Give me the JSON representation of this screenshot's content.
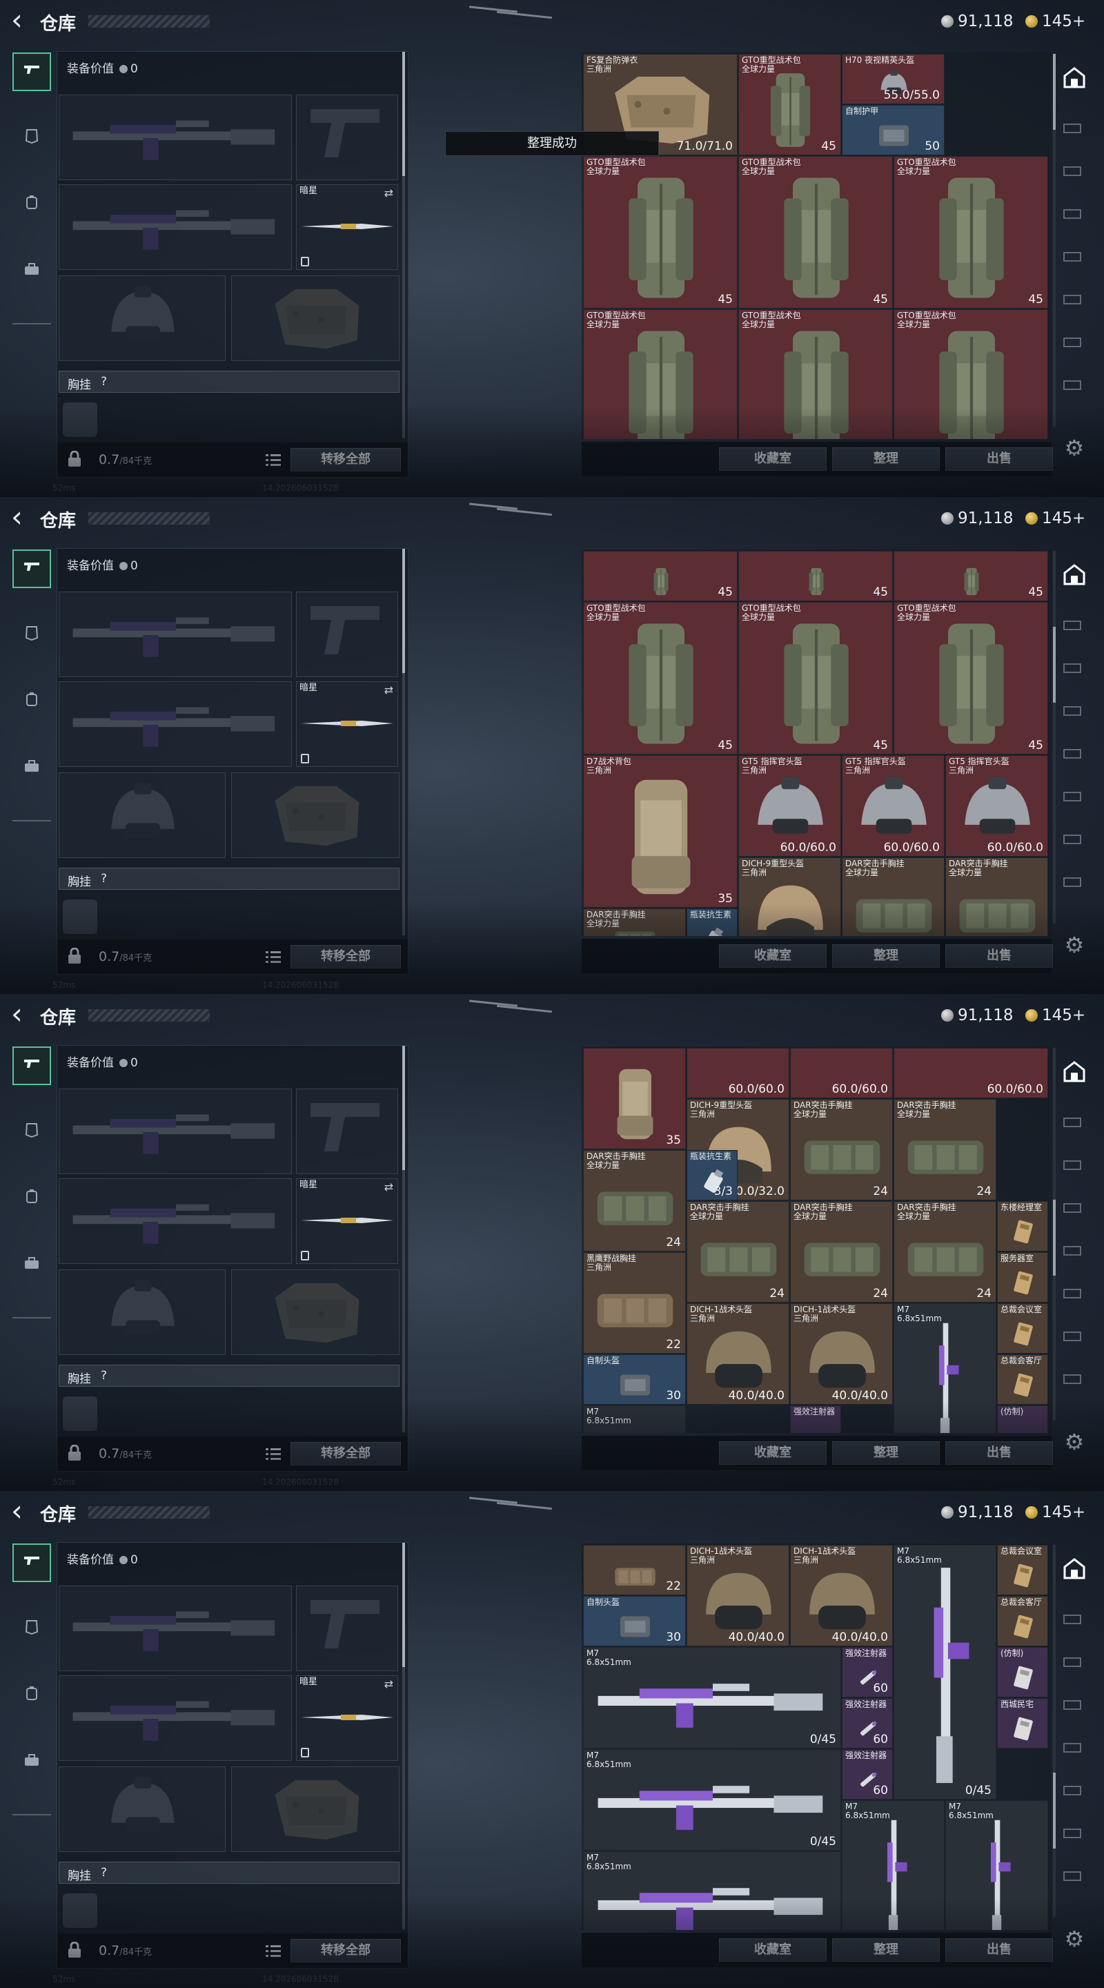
{
  "app": {
    "title": "仓库",
    "back_icon": "back-arrow-icon"
  },
  "currency": {
    "silver": "91,118",
    "gold": "145+"
  },
  "left_nav": [
    "gun-icon",
    "armor-icon",
    "backpack-icon",
    "briefcase-icon"
  ],
  "equipment": {
    "value_label": "装备价值",
    "value": "0",
    "secondary_slot_label": "暗星",
    "chest_label": "胸挂",
    "chest_help": "?",
    "weight": "0.7",
    "weight_unit": "/84千克",
    "transfer_all": "转移全部"
  },
  "inventory_footer": {
    "collection": "收藏室",
    "organize": "整理",
    "sell": "出售"
  },
  "toast": "整理成功",
  "status": {
    "ping": "52ms",
    "build": "14.20260603152B"
  },
  "panels": [
    {
      "cells": [
        {
          "name": "FS复合防弹衣\n三角洲",
          "value": "71.0/71.0",
          "bg": "brown",
          "art": "vest",
          "c": 0,
          "r": 0,
          "w": 3,
          "h": 2
        },
        {
          "name": "GTO重型战术包\n全球力量",
          "value": "45",
          "bg": "red",
          "art": "backpack",
          "c": 3,
          "r": 0,
          "w": 2,
          "h": 2
        },
        {
          "name": "H70 夜视精英头盔",
          "value": "55.0/55.0",
          "bg": "red",
          "art": "helmet",
          "c": 5,
          "r": 0,
          "w": 2,
          "h": 1
        },
        {
          "name": "自制护甲",
          "value": "50",
          "bg": "blue",
          "art": "plate",
          "c": 5,
          "r": 1,
          "w": 2,
          "h": 1
        },
        {
          "name": "GTO重型战术包\n全球力量",
          "value": "45",
          "bg": "red",
          "art": "backpack",
          "c": 0,
          "r": 2,
          "w": 3,
          "h": 3
        },
        {
          "name": "GTO重型战术包\n全球力量",
          "value": "45",
          "bg": "red",
          "art": "backpack",
          "c": 3,
          "r": 2,
          "w": 3,
          "h": 3
        },
        {
          "name": "GTO重型战术包\n全球力量",
          "value": "45",
          "bg": "red",
          "art": "backpack",
          "c": 6,
          "r": 2,
          "w": 3,
          "h": 3
        },
        {
          "name": "GTO重型战术包\n全球力量",
          "value": "",
          "bg": "red",
          "art": "backpack",
          "c": 0,
          "r": 5,
          "w": 3,
          "h": 3
        },
        {
          "name": "GTO重型战术包\n全球力量",
          "value": "",
          "bg": "red",
          "art": "backpack",
          "c": 3,
          "r": 5,
          "w": 3,
          "h": 3
        },
        {
          "name": "GTO重型战术包\n全球力量",
          "value": "",
          "bg": "red",
          "art": "backpack",
          "c": 6,
          "r": 5,
          "w": 3,
          "h": 3
        }
      ]
    },
    {
      "cells": [
        {
          "name": "",
          "value": "45",
          "bg": "red",
          "art": "backpack",
          "c": 0,
          "r": 0,
          "w": 3,
          "h": 1
        },
        {
          "name": "",
          "value": "45",
          "bg": "red",
          "art": "backpack",
          "c": 3,
          "r": 0,
          "w": 3,
          "h": 1
        },
        {
          "name": "",
          "value": "45",
          "bg": "red",
          "art": "backpack",
          "c": 6,
          "r": 0,
          "w": 3,
          "h": 1
        },
        {
          "name": "GTO重型战术包\n全球力量",
          "value": "45",
          "bg": "red",
          "art": "backpack",
          "c": 0,
          "r": 1,
          "w": 3,
          "h": 3
        },
        {
          "name": "GTO重型战术包\n全球力量",
          "value": "45",
          "bg": "red",
          "art": "backpack",
          "c": 3,
          "r": 1,
          "w": 3,
          "h": 3
        },
        {
          "name": "GTO重型战术包\n全球力量",
          "value": "45",
          "bg": "red",
          "art": "backpack",
          "c": 6,
          "r": 1,
          "w": 3,
          "h": 3
        },
        {
          "name": "D7战术背包\n三角洲",
          "value": "35",
          "bg": "red",
          "art": "backpack2",
          "c": 0,
          "r": 4,
          "w": 3,
          "h": 3
        },
        {
          "name": "GT5 指挥官头盔\n三角洲",
          "value": "60.0/60.0",
          "bg": "red",
          "art": "helmet",
          "c": 3,
          "r": 4,
          "w": 2,
          "h": 2
        },
        {
          "name": "GT5 指挥官头盔\n三角洲",
          "value": "60.0/60.0",
          "bg": "red",
          "art": "helmet",
          "c": 5,
          "r": 4,
          "w": 2,
          "h": 2
        },
        {
          "name": "GT5 指挥官头盔\n三角洲",
          "value": "60.0/60.0",
          "bg": "red",
          "art": "helmet",
          "c": 7,
          "r": 4,
          "w": 2,
          "h": 2
        },
        {
          "name": "DICH-9重型头盔\n三角洲",
          "value": "",
          "bg": "brown",
          "art": "helmet2",
          "c": 3,
          "r": 6,
          "w": 2,
          "h": 2
        },
        {
          "name": "DAR突击手胸挂\n全球力量",
          "value": "",
          "bg": "brown",
          "art": "rig",
          "c": 5,
          "r": 6,
          "w": 2,
          "h": 2
        },
        {
          "name": "DAR突击手胸挂\n全球力量",
          "value": "",
          "bg": "brown",
          "art": "rig",
          "c": 7,
          "r": 6,
          "w": 2,
          "h": 2
        },
        {
          "name": "DAR突击手胸挂\n全球力量",
          "value": "",
          "bg": "brown",
          "art": "rig",
          "c": 0,
          "r": 7,
          "w": 2,
          "h": 1
        },
        {
          "name": "瓶装抗生素",
          "value": "",
          "bg": "blue",
          "art": "bottle",
          "c": 2,
          "r": 7,
          "w": 1,
          "h": 1
        }
      ]
    },
    {
      "cells": [
        {
          "name": "",
          "value": "35",
          "bg": "red",
          "art": "backpack2",
          "c": 0,
          "r": 0,
          "w": 2,
          "h": 2
        },
        {
          "name": "",
          "value": "60.0/60.0",
          "bg": "red",
          "art": "none",
          "c": 2,
          "r": 0,
          "w": 2,
          "h": 1
        },
        {
          "name": "",
          "value": "60.0/60.0",
          "bg": "red",
          "art": "none",
          "c": 4,
          "r": 0,
          "w": 2,
          "h": 1
        },
        {
          "name": "",
          "value": "60.0/60.0",
          "bg": "red",
          "art": "none",
          "c": 6,
          "r": 0,
          "w": 3,
          "h": 1
        },
        {
          "name": "DICH-9重型头盔\n三角洲",
          "value": "30.0/32.0",
          "bg": "brown",
          "art": "helmet2",
          "c": 2,
          "r": 1,
          "w": 2,
          "h": 2
        },
        {
          "name": "DAR突击手胸挂\n全球力量",
          "value": "24",
          "bg": "brown",
          "art": "rig",
          "c": 4,
          "r": 1,
          "w": 2,
          "h": 2
        },
        {
          "name": "DAR突击手胸挂\n全球力量",
          "value": "24",
          "bg": "brown",
          "art": "rig",
          "c": 6,
          "r": 1,
          "w": 2,
          "h": 2
        },
        {
          "name": "DAR突击手胸挂\n全球力量",
          "value": "24",
          "bg": "brown",
          "art": "rig",
          "c": 0,
          "r": 2,
          "w": 2,
          "h": 2
        },
        {
          "name": "瓶装抗生素",
          "value": "3/3",
          "bg": "blue",
          "art": "bottle",
          "c": 2,
          "r": 2,
          "w": 1,
          "h": 1
        },
        {
          "name": "DAR突击手胸挂\n全球力量",
          "value": "24",
          "bg": "brown",
          "art": "rig",
          "c": 2,
          "r": 3,
          "w": 2,
          "h": 2
        },
        {
          "name": "DAR突击手胸挂\n全球力量",
          "value": "24",
          "bg": "brown",
          "art": "rig",
          "c": 4,
          "r": 3,
          "w": 2,
          "h": 2
        },
        {
          "name": "DAR突击手胸挂\n全球力量",
          "value": "24",
          "bg": "brown",
          "art": "rig",
          "c": 6,
          "r": 3,
          "w": 2,
          "h": 2
        },
        {
          "name": "东楼经理室",
          "value": "",
          "bg": "brown",
          "art": "card",
          "c": 8,
          "r": 3,
          "w": 1,
          "h": 1
        },
        {
          "name": "服务器室",
          "value": "",
          "bg": "brown",
          "art": "card",
          "c": 8,
          "r": 4,
          "w": 1,
          "h": 1
        },
        {
          "name": "黑鹰野战胸挂\n三角洲",
          "value": "22",
          "bg": "brown",
          "art": "rig2",
          "c": 0,
          "r": 4,
          "w": 2,
          "h": 2
        },
        {
          "name": "DICH-1战术头盔\n三角洲",
          "value": "40.0/40.0",
          "bg": "brown",
          "art": "helmet3",
          "c": 2,
          "r": 5,
          "w": 2,
          "h": 2
        },
        {
          "name": "DICH-1战术头盔\n三角洲",
          "value": "40.0/40.0",
          "bg": "brown",
          "art": "helmet3",
          "c": 4,
          "r": 5,
          "w": 2,
          "h": 2
        },
        {
          "name": "M7\n6.8x51mm",
          "value": "",
          "bg": "gray",
          "art": "rifle-v",
          "c": 6,
          "r": 5,
          "w": 2,
          "h": 3
        },
        {
          "name": "总裁会议室",
          "value": "",
          "bg": "brown",
          "art": "card",
          "c": 8,
          "r": 5,
          "w": 1,
          "h": 1
        },
        {
          "name": "总裁会客厅",
          "value": "",
          "bg": "brown",
          "art": "card",
          "c": 8,
          "r": 6,
          "w": 1,
          "h": 1
        },
        {
          "name": "自制头盔",
          "value": "30",
          "bg": "blue",
          "art": "plate",
          "c": 0,
          "r": 6,
          "w": 2,
          "h": 1
        },
        {
          "name": "M7\n6.8x51mm",
          "value": "",
          "bg": "gray",
          "art": "none",
          "c": 0,
          "r": 7,
          "w": 2,
          "h": 1
        },
        {
          "name": "强效注射器",
          "value": "",
          "bg": "purple",
          "art": "none",
          "c": 4,
          "r": 7,
          "w": 1,
          "h": 1
        },
        {
          "name": "(仿制)",
          "value": "",
          "bg": "purple",
          "art": "none",
          "c": 8,
          "r": 7,
          "w": 1,
          "h": 1
        }
      ]
    },
    {
      "cells": [
        {
          "name": "",
          "value": "22",
          "bg": "brown",
          "art": "rig2",
          "c": 0,
          "r": 0,
          "w": 2,
          "h": 1
        },
        {
          "name": "DICH-1战术头盔\n三角洲",
          "value": "40.0/40.0",
          "bg": "brown",
          "art": "helmet3",
          "c": 2,
          "r": 0,
          "w": 2,
          "h": 2
        },
        {
          "name": "DICH-1战术头盔\n三角洲",
          "value": "40.0/40.0",
          "bg": "brown",
          "art": "helmet3",
          "c": 4,
          "r": 0,
          "w": 2,
          "h": 2
        },
        {
          "name": "M7\n6.8x51mm",
          "value": "0/45",
          "bg": "gray",
          "art": "rifle-v",
          "c": 6,
          "r": 0,
          "w": 2,
          "h": 5
        },
        {
          "name": "总裁会议室",
          "value": "",
          "bg": "brown",
          "art": "card",
          "c": 8,
          "r": 0,
          "w": 1,
          "h": 1
        },
        {
          "name": "总裁会客厅",
          "value": "",
          "bg": "brown",
          "art": "card",
          "c": 8,
          "r": 1,
          "w": 1,
          "h": 1
        },
        {
          "name": "自制头盔",
          "value": "30",
          "bg": "blue",
          "art": "plate",
          "c": 0,
          "r": 1,
          "w": 2,
          "h": 1
        },
        {
          "name": "M7\n6.8x51mm",
          "value": "0/45",
          "bg": "gray",
          "art": "rifle-h",
          "c": 0,
          "r": 2,
          "w": 5,
          "h": 2
        },
        {
          "name": "强效注射器",
          "value": "60",
          "bg": "purple",
          "art": "injector",
          "c": 5,
          "r": 2,
          "w": 1,
          "h": 1
        },
        {
          "name": "(仿制)",
          "value": "",
          "bg": "purple",
          "art": "card2",
          "c": 8,
          "r": 2,
          "w": 1,
          "h": 1
        },
        {
          "name": "强效注射器",
          "value": "60",
          "bg": "purple",
          "art": "injector",
          "c": 5,
          "r": 3,
          "w": 1,
          "h": 1
        },
        {
          "name": "西城民宅",
          "value": "",
          "bg": "purple",
          "art": "card2",
          "c": 8,
          "r": 3,
          "w": 1,
          "h": 1
        },
        {
          "name": "M7\n6.8x51mm",
          "value": "0/45",
          "bg": "gray",
          "art": "rifle-h",
          "c": 0,
          "r": 4,
          "w": 5,
          "h": 2
        },
        {
          "name": "强效注射器",
          "value": "60",
          "bg": "purple",
          "art": "injector",
          "c": 5,
          "r": 4,
          "w": 1,
          "h": 1
        },
        {
          "name": "M7\n6.8x51mm",
          "value": "",
          "bg": "gray",
          "art": "rifle-v",
          "c": 5,
          "r": 5,
          "w": 2,
          "h": 3
        },
        {
          "name": "M7\n6.8x51mm",
          "value": "",
          "bg": "gray",
          "art": "rifle-v",
          "c": 7,
          "r": 5,
          "w": 2,
          "h": 3
        },
        {
          "name": "M7\n6.8x51mm",
          "value": "",
          "bg": "gray",
          "art": "rifle-h",
          "c": 0,
          "r": 6,
          "w": 5,
          "h": 2
        }
      ]
    }
  ]
}
